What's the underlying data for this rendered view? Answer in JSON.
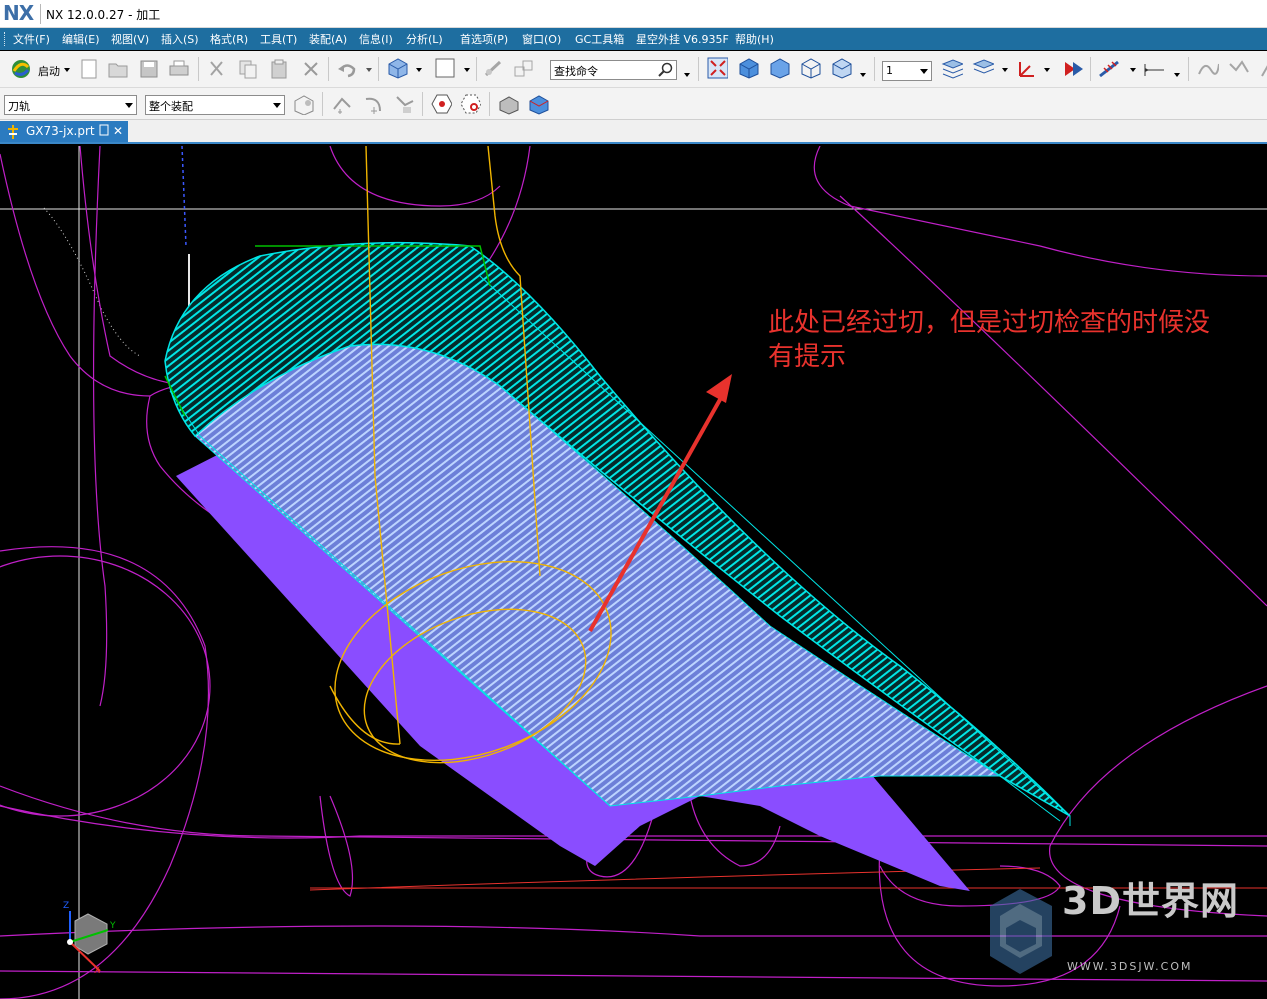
{
  "app": {
    "logo": "NX",
    "title": "NX 12.0.0.27 - 加工"
  },
  "menu": [
    "文件(F)",
    "编辑(E)",
    "视图(V)",
    "插入(S)",
    "格式(R)",
    "工具(T)",
    "装配(A)",
    "信息(I)",
    "分析(L)",
    "首选项(P)",
    "窗口(O)",
    "GC工具箱",
    "星空外挂 V6.935F",
    "帮助(H)"
  ],
  "toolbar": {
    "start_label": "启动",
    "search_placeholder": "查找命令",
    "layer_value": "1"
  },
  "filters": {
    "type_filter": "刀轨",
    "scope_filter": "整个装配"
  },
  "tabs": [
    {
      "label": "GX73-jx.prt"
    }
  ],
  "viewport": {
    "annotation_line1": "此处已经过切，但是过切检查的时候没",
    "annotation_line2": "有提示",
    "triad": {
      "z": "Z",
      "y": "Y",
      "x": "X"
    },
    "colors": {
      "toolpath": "#00e5e5",
      "surface": "#8a4dff",
      "tool": "#f0b400",
      "geometry": "#c020c8",
      "arrow": "#e8322d"
    }
  },
  "watermark": {
    "brand": "3D世界网",
    "url": "WWW.3DSJW.COM"
  }
}
